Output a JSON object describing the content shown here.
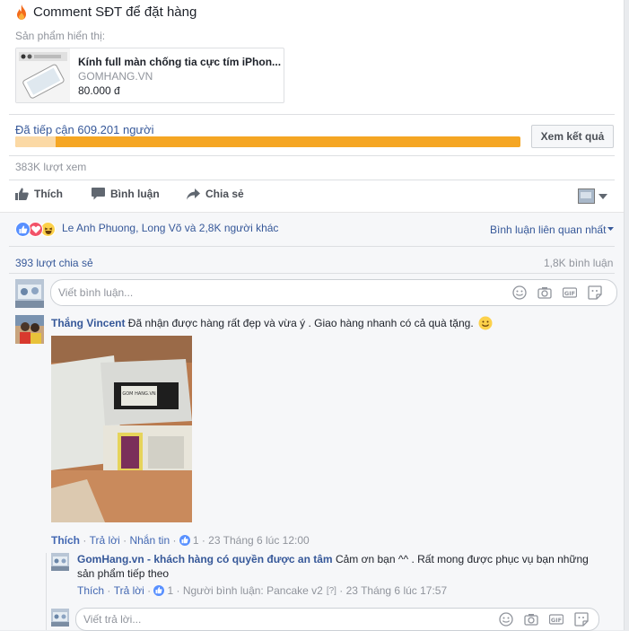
{
  "post": {
    "headline": "Comment SĐT để đặt hàng",
    "shown_product_label": "Sản phẩm hiển thị:",
    "product": {
      "title": "Kính full màn chống tia cực tím iPhon...",
      "site": "GOMHANG.VN",
      "price": "80.000 đ"
    },
    "reach_text": "Đã tiếp cận 609.201 người",
    "reach_fraction": 0.08,
    "results_button": "Xem kết quả",
    "views": "383K lượt xem"
  },
  "actions": {
    "like": "Thích",
    "comment": "Bình luận",
    "share": "Chia sẻ"
  },
  "reactions": {
    "names": "Le Anh Phuong, Long Võ và 2,8K người khác",
    "sort": "Bình luận liên quan nhất",
    "shares": "393 lượt chia sẻ",
    "comment_count": "1,8K bình luận"
  },
  "comment_input": {
    "placeholder": "Viết bình luận..."
  },
  "comment": {
    "author": "Thắng Vincent",
    "text": "Đã nhận được hàng rất đẹp và vừa ý . Giao hàng nhanh có cả quà tặng.",
    "like": "Thích",
    "reply": "Trả lời",
    "message": "Nhắn tin",
    "likes": "1",
    "date": "23 Tháng 6 lúc 12:00"
  },
  "reply": {
    "author": "GomHang.vn - khách hàng có quyền được an tâm",
    "text": "Cảm ơn bạn ^^ . Rất mong được phục vụ bạn những sản phẩm tiếp theo",
    "like": "Thích",
    "reply": "Trả lời",
    "likes": "1",
    "responder": "Người bình luận: Pancake v2",
    "qmark": "[?]",
    "date": "23 Tháng 6 lúc 17:57"
  },
  "reply_input": {
    "placeholder": "Viết trả lời..."
  },
  "colors": {
    "link": "#365899",
    "bar": "#f5a623",
    "bar_fill": "#fbd9a5"
  }
}
